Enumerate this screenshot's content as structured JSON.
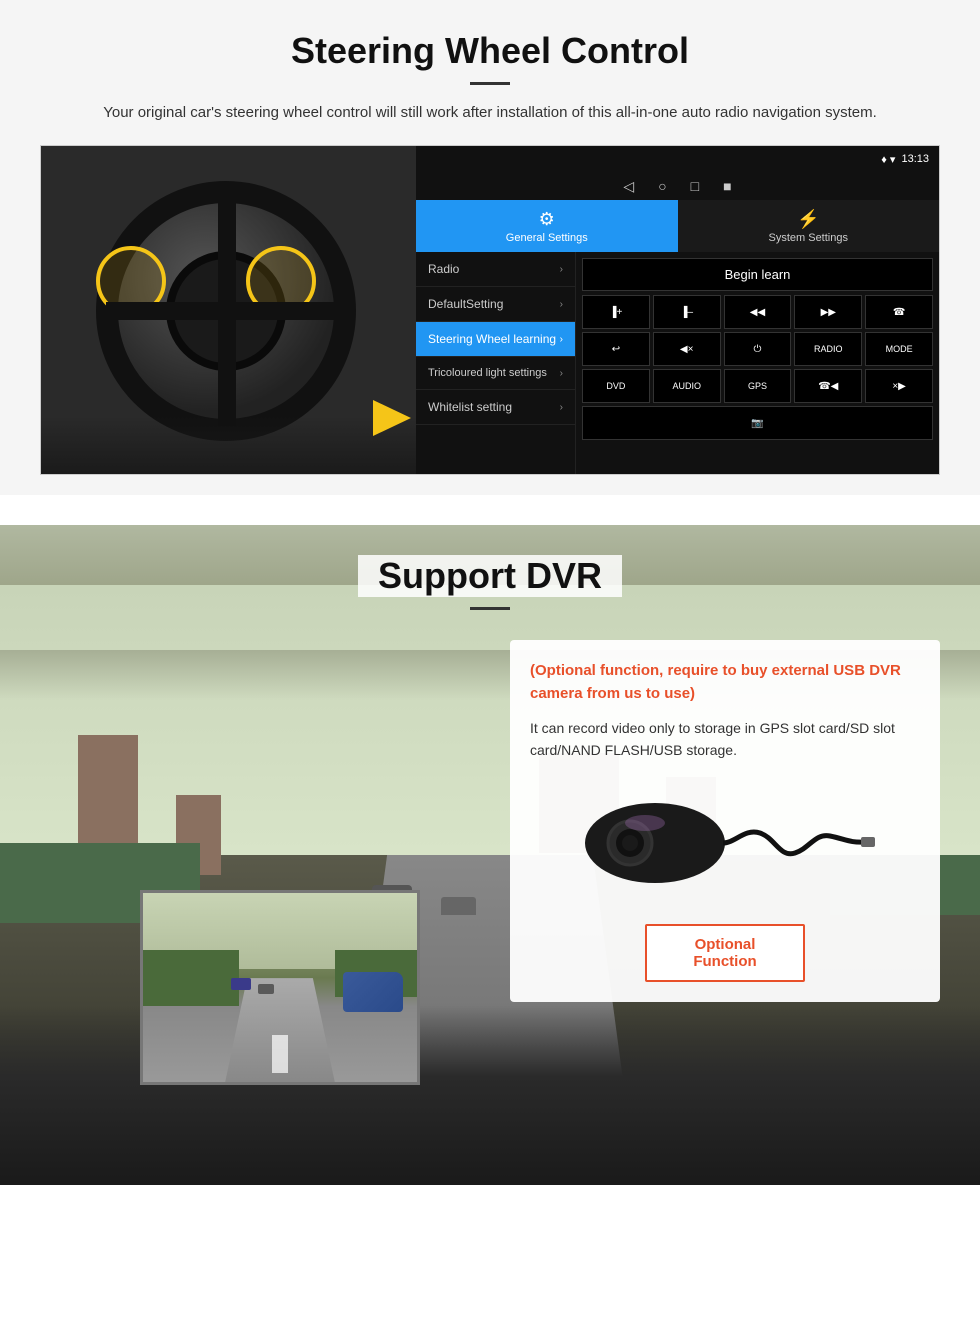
{
  "page": {
    "title": "Steering Wheel Control",
    "title_divider": true,
    "description": "Your original car's steering wheel control will still work after installation of this all-in-one auto radio navigation system."
  },
  "android_ui": {
    "statusbar": {
      "time": "13:13",
      "wifi_icon": "▲",
      "signal_icon": "▲"
    },
    "nav_buttons": [
      "◁",
      "○",
      "□",
      "■"
    ],
    "tabs": [
      {
        "label": "General Settings",
        "icon": "⚙",
        "active": true
      },
      {
        "label": "System Settings",
        "icon": "⚡",
        "active": false
      }
    ],
    "menu_items": [
      {
        "label": "Radio",
        "active": false
      },
      {
        "label": "DefaultSetting",
        "active": false
      },
      {
        "label": "Steering Wheel learning",
        "active": true
      },
      {
        "label": "Tricoloured light settings",
        "active": false
      },
      {
        "label": "Whitelist setting",
        "active": false
      }
    ],
    "begin_learn_label": "Begin learn",
    "control_buttons_row1": [
      "▐+",
      "▐–",
      "◀◀",
      "▶▶",
      "☎"
    ],
    "control_buttons_row2": [
      "↩",
      "◀×",
      "⏻",
      "RADIO",
      "MODE"
    ],
    "control_buttons_row3": [
      "DVD",
      "AUDIO",
      "GPS",
      "☎◀◀",
      "×▶▶"
    ],
    "control_buttons_row4": [
      "📷"
    ]
  },
  "dvr_section": {
    "title": "Support DVR",
    "optional_text": "(Optional function, require to buy external USB DVR camera from us to use)",
    "description": "It can record video only to storage in GPS slot card/SD slot card/NAND FLASH/USB storage.",
    "optional_button_label": "Optional Function"
  }
}
